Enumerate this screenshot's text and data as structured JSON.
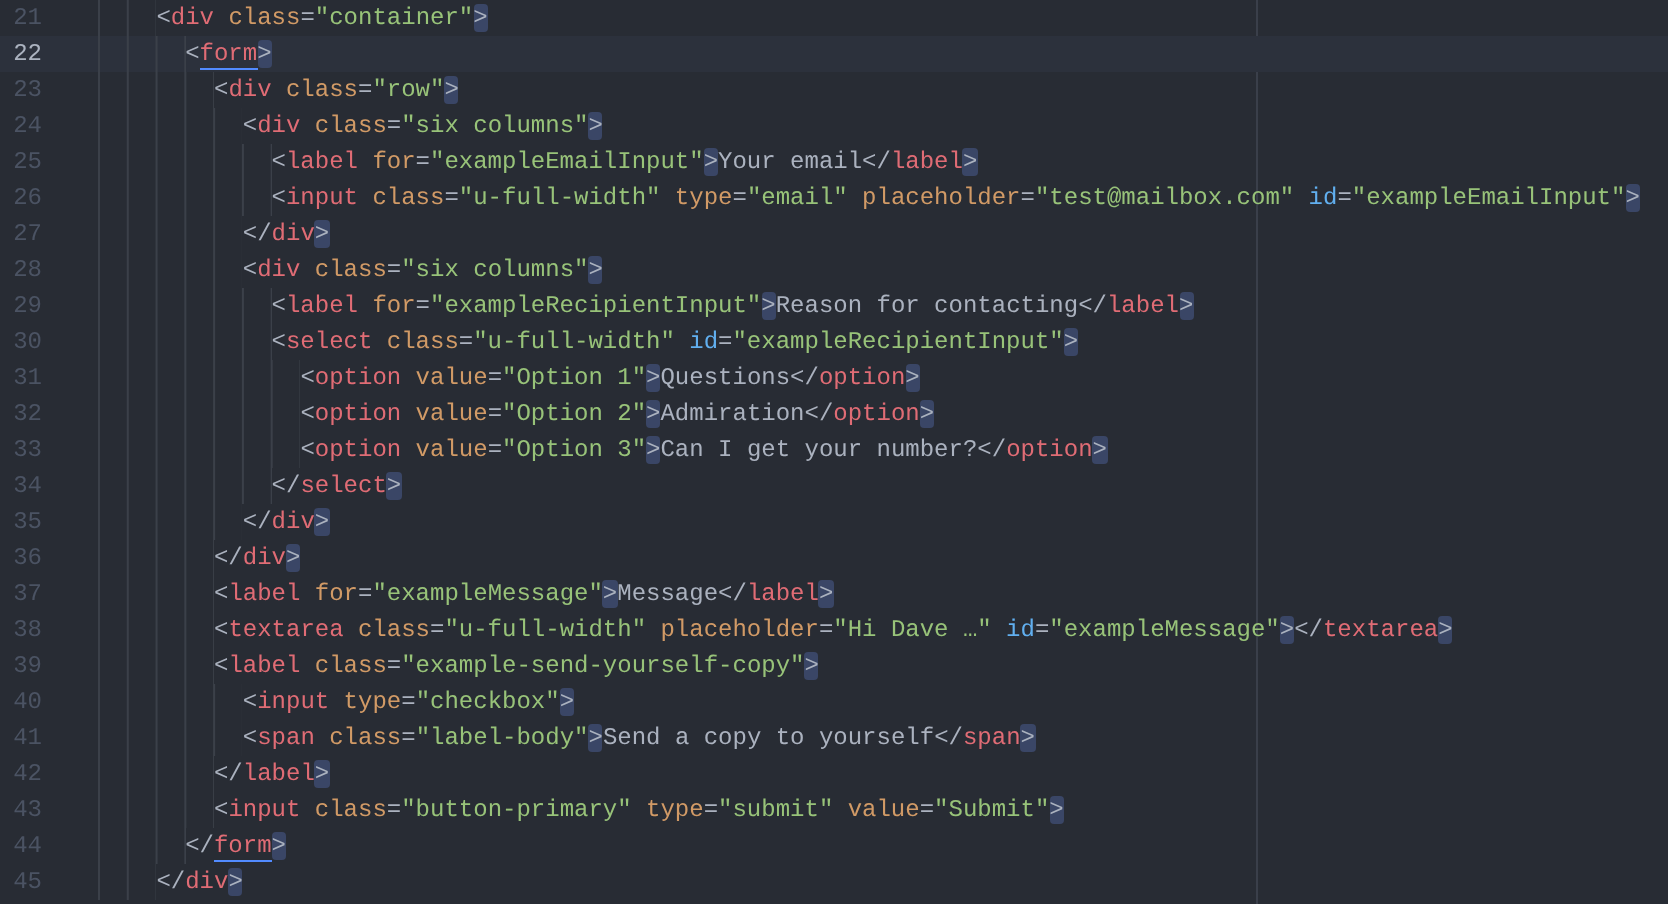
{
  "editor": {
    "lines": [
      {
        "number": "21",
        "current": false,
        "tokens": [
          {
            "kind": "punct",
            "text": "<"
          },
          {
            "kind": "tag",
            "text": "div"
          },
          {
            "kind": "attr",
            "text": "class"
          },
          {
            "kind": "punct",
            "text": "="
          },
          {
            "kind": "string",
            "text": "\"container\""
          },
          {
            "kind": "bracket",
            "text": ">"
          }
        ],
        "children": [
          {
            "number": "22",
            "current": true,
            "tokens": [
              {
                "kind": "punct",
                "text": "<"
              },
              {
                "kind": "tag-match",
                "text": "form"
              },
              {
                "kind": "bracket",
                "text": ">"
              }
            ],
            "children": [
              {
                "number": "23",
                "current": false,
                "tokens": [
                  {
                    "kind": "punct",
                    "text": "<"
                  },
                  {
                    "kind": "tag",
                    "text": "div"
                  },
                  {
                    "kind": "attr",
                    "text": "class"
                  },
                  {
                    "kind": "punct",
                    "text": "="
                  },
                  {
                    "kind": "string",
                    "text": "\"row\""
                  },
                  {
                    "kind": "bracket",
                    "text": ">"
                  }
                ],
                "children": [
                  {
                    "number": "24",
                    "current": false,
                    "tokens": [
                      {
                        "kind": "punct",
                        "text": "<"
                      },
                      {
                        "kind": "tag",
                        "text": "div"
                      },
                      {
                        "kind": "attr",
                        "text": "class"
                      },
                      {
                        "kind": "punct",
                        "text": "="
                      },
                      {
                        "kind": "string",
                        "text": "\"six columns\""
                      },
                      {
                        "kind": "bracket",
                        "text": ">"
                      }
                    ],
                    "children": [
                      {
                        "number": "25",
                        "current": false,
                        "tokens": [
                          {
                            "kind": "punct",
                            "text": "<"
                          },
                          {
                            "kind": "tag",
                            "text": "label"
                          },
                          {
                            "kind": "attr",
                            "text": "for"
                          },
                          {
                            "kind": "punct",
                            "text": "="
                          },
                          {
                            "kind": "string",
                            "text": "\"exampleEmailInput\""
                          },
                          {
                            "kind": "bracket",
                            "text": ">"
                          },
                          {
                            "kind": "text",
                            "text": "Your email"
                          },
                          {
                            "kind": "punct",
                            "text": "</"
                          },
                          {
                            "kind": "tag",
                            "text": "label"
                          },
                          {
                            "kind": "bracket",
                            "text": ">"
                          }
                        ]
                      },
                      {
                        "number": "26",
                        "current": false,
                        "tokens": [
                          {
                            "kind": "punct",
                            "text": "<"
                          },
                          {
                            "kind": "tag",
                            "text": "input"
                          },
                          {
                            "kind": "attr",
                            "text": "class"
                          },
                          {
                            "kind": "punct",
                            "text": "="
                          },
                          {
                            "kind": "string",
                            "text": "\"u-full-width\""
                          },
                          {
                            "kind": "attr",
                            "text": "type"
                          },
                          {
                            "kind": "punct",
                            "text": "="
                          },
                          {
                            "kind": "string",
                            "text": "\"email\""
                          },
                          {
                            "kind": "attr",
                            "text": "placeholder"
                          },
                          {
                            "kind": "punct",
                            "text": "="
                          },
                          {
                            "kind": "string",
                            "text": "\"test@mailbox.com\""
                          },
                          {
                            "kind": "id",
                            "text": "id"
                          },
                          {
                            "kind": "punct",
                            "text": "="
                          },
                          {
                            "kind": "string",
                            "text": "\"exampleEmailInput\""
                          },
                          {
                            "kind": "bracket",
                            "text": ">"
                          }
                        ]
                      }
                    ]
                  },
                  {
                    "number": "27",
                    "current": false,
                    "tokens": [
                      {
                        "kind": "punct",
                        "text": "</"
                      },
                      {
                        "kind": "tag",
                        "text": "div"
                      },
                      {
                        "kind": "bracket",
                        "text": ">"
                      }
                    ]
                  },
                  {
                    "number": "28",
                    "current": false,
                    "tokens": [
                      {
                        "kind": "punct",
                        "text": "<"
                      },
                      {
                        "kind": "tag",
                        "text": "div"
                      },
                      {
                        "kind": "attr",
                        "text": "class"
                      },
                      {
                        "kind": "punct",
                        "text": "="
                      },
                      {
                        "kind": "string",
                        "text": "\"six columns\""
                      },
                      {
                        "kind": "bracket",
                        "text": ">"
                      }
                    ],
                    "children": [
                      {
                        "number": "29",
                        "current": false,
                        "tokens": [
                          {
                            "kind": "punct",
                            "text": "<"
                          },
                          {
                            "kind": "tag",
                            "text": "label"
                          },
                          {
                            "kind": "attr",
                            "text": "for"
                          },
                          {
                            "kind": "punct",
                            "text": "="
                          },
                          {
                            "kind": "string",
                            "text": "\"exampleRecipientInput\""
                          },
                          {
                            "kind": "bracket",
                            "text": ">"
                          },
                          {
                            "kind": "text",
                            "text": "Reason for contacting"
                          },
                          {
                            "kind": "punct",
                            "text": "</"
                          },
                          {
                            "kind": "tag",
                            "text": "label"
                          },
                          {
                            "kind": "bracket",
                            "text": ">"
                          }
                        ]
                      },
                      {
                        "number": "30",
                        "current": false,
                        "tokens": [
                          {
                            "kind": "punct",
                            "text": "<"
                          },
                          {
                            "kind": "tag",
                            "text": "select"
                          },
                          {
                            "kind": "attr",
                            "text": "class"
                          },
                          {
                            "kind": "punct",
                            "text": "="
                          },
                          {
                            "kind": "string",
                            "text": "\"u-full-width\""
                          },
                          {
                            "kind": "id",
                            "text": "id"
                          },
                          {
                            "kind": "punct",
                            "text": "="
                          },
                          {
                            "kind": "string",
                            "text": "\"exampleRecipientInput\""
                          },
                          {
                            "kind": "bracket",
                            "text": ">"
                          }
                        ],
                        "children": [
                          {
                            "number": "31",
                            "current": false,
                            "tokens": [
                              {
                                "kind": "punct",
                                "text": "<"
                              },
                              {
                                "kind": "tag",
                                "text": "option"
                              },
                              {
                                "kind": "attr",
                                "text": "value"
                              },
                              {
                                "kind": "punct",
                                "text": "="
                              },
                              {
                                "kind": "string",
                                "text": "\"Option 1\""
                              },
                              {
                                "kind": "bracket",
                                "text": ">"
                              },
                              {
                                "kind": "text",
                                "text": "Questions"
                              },
                              {
                                "kind": "punct",
                                "text": "</"
                              },
                              {
                                "kind": "tag",
                                "text": "option"
                              },
                              {
                                "kind": "bracket",
                                "text": ">"
                              }
                            ]
                          },
                          {
                            "number": "32",
                            "current": false,
                            "tokens": [
                              {
                                "kind": "punct",
                                "text": "<"
                              },
                              {
                                "kind": "tag",
                                "text": "option"
                              },
                              {
                                "kind": "attr",
                                "text": "value"
                              },
                              {
                                "kind": "punct",
                                "text": "="
                              },
                              {
                                "kind": "string",
                                "text": "\"Option 2\""
                              },
                              {
                                "kind": "bracket",
                                "text": ">"
                              },
                              {
                                "kind": "text",
                                "text": "Admiration"
                              },
                              {
                                "kind": "punct",
                                "text": "</"
                              },
                              {
                                "kind": "tag",
                                "text": "option"
                              },
                              {
                                "kind": "bracket",
                                "text": ">"
                              }
                            ]
                          },
                          {
                            "number": "33",
                            "current": false,
                            "tokens": [
                              {
                                "kind": "punct",
                                "text": "<"
                              },
                              {
                                "kind": "tag",
                                "text": "option"
                              },
                              {
                                "kind": "attr",
                                "text": "value"
                              },
                              {
                                "kind": "punct",
                                "text": "="
                              },
                              {
                                "kind": "string",
                                "text": "\"Option 3\""
                              },
                              {
                                "kind": "bracket",
                                "text": ">"
                              },
                              {
                                "kind": "text",
                                "text": "Can I get your number?"
                              },
                              {
                                "kind": "punct",
                                "text": "</"
                              },
                              {
                                "kind": "tag",
                                "text": "option"
                              },
                              {
                                "kind": "bracket",
                                "text": ">"
                              }
                            ]
                          }
                        ]
                      },
                      {
                        "number": "34",
                        "current": false,
                        "tokens": [
                          {
                            "kind": "punct",
                            "text": "</"
                          },
                          {
                            "kind": "tag",
                            "text": "select"
                          },
                          {
                            "kind": "bracket",
                            "text": ">"
                          }
                        ]
                      }
                    ]
                  },
                  {
                    "number": "35",
                    "current": false,
                    "tokens": [
                      {
                        "kind": "punct",
                        "text": "</"
                      },
                      {
                        "kind": "tag",
                        "text": "div"
                      },
                      {
                        "kind": "bracket",
                        "text": ">"
                      }
                    ]
                  }
                ]
              },
              {
                "number": "36",
                "current": false,
                "tokens": [
                  {
                    "kind": "punct",
                    "text": "</"
                  },
                  {
                    "kind": "tag",
                    "text": "div"
                  },
                  {
                    "kind": "bracket",
                    "text": ">"
                  }
                ]
              },
              {
                "number": "37",
                "current": false,
                "tokens": [
                  {
                    "kind": "punct",
                    "text": "<"
                  },
                  {
                    "kind": "tag",
                    "text": "label"
                  },
                  {
                    "kind": "attr",
                    "text": "for"
                  },
                  {
                    "kind": "punct",
                    "text": "="
                  },
                  {
                    "kind": "string",
                    "text": "\"exampleMessage\""
                  },
                  {
                    "kind": "bracket",
                    "text": ">"
                  },
                  {
                    "kind": "text",
                    "text": "Message"
                  },
                  {
                    "kind": "punct",
                    "text": "</"
                  },
                  {
                    "kind": "tag",
                    "text": "label"
                  },
                  {
                    "kind": "bracket",
                    "text": ">"
                  }
                ]
              },
              {
                "number": "38",
                "current": false,
                "tokens": [
                  {
                    "kind": "punct",
                    "text": "<"
                  },
                  {
                    "kind": "tag",
                    "text": "textarea"
                  },
                  {
                    "kind": "attr",
                    "text": "class"
                  },
                  {
                    "kind": "punct",
                    "text": "="
                  },
                  {
                    "kind": "string",
                    "text": "\"u-full-width\""
                  },
                  {
                    "kind": "attr",
                    "text": "placeholder"
                  },
                  {
                    "kind": "punct",
                    "text": "="
                  },
                  {
                    "kind": "string",
                    "text": "\"Hi Dave …\""
                  },
                  {
                    "kind": "id",
                    "text": "id"
                  },
                  {
                    "kind": "punct",
                    "text": "="
                  },
                  {
                    "kind": "string",
                    "text": "\"exampleMessage\""
                  },
                  {
                    "kind": "bracket",
                    "text": ">"
                  },
                  {
                    "kind": "punct",
                    "text": "</"
                  },
                  {
                    "kind": "tag",
                    "text": "textarea"
                  },
                  {
                    "kind": "bracket",
                    "text": ">"
                  }
                ]
              },
              {
                "number": "39",
                "current": false,
                "tokens": [
                  {
                    "kind": "punct",
                    "text": "<"
                  },
                  {
                    "kind": "tag",
                    "text": "label"
                  },
                  {
                    "kind": "attr",
                    "text": "class"
                  },
                  {
                    "kind": "punct",
                    "text": "="
                  },
                  {
                    "kind": "string",
                    "text": "\"example-send-yourself-copy\""
                  },
                  {
                    "kind": "bracket",
                    "text": ">"
                  }
                ],
                "children": [
                  {
                    "number": "40",
                    "current": false,
                    "tokens": [
                      {
                        "kind": "punct",
                        "text": "<"
                      },
                      {
                        "kind": "tag",
                        "text": "input"
                      },
                      {
                        "kind": "attr",
                        "text": "type"
                      },
                      {
                        "kind": "punct",
                        "text": "="
                      },
                      {
                        "kind": "string",
                        "text": "\"checkbox\""
                      },
                      {
                        "kind": "bracket",
                        "text": ">"
                      }
                    ]
                  },
                  {
                    "number": "41",
                    "current": false,
                    "tokens": [
                      {
                        "kind": "punct",
                        "text": "<"
                      },
                      {
                        "kind": "tag",
                        "text": "span"
                      },
                      {
                        "kind": "attr",
                        "text": "class"
                      },
                      {
                        "kind": "punct",
                        "text": "="
                      },
                      {
                        "kind": "string",
                        "text": "\"label-body\""
                      },
                      {
                        "kind": "bracket",
                        "text": ">"
                      },
                      {
                        "kind": "text",
                        "text": "Send a copy to yourself"
                      },
                      {
                        "kind": "punct",
                        "text": "</"
                      },
                      {
                        "kind": "tag",
                        "text": "span"
                      },
                      {
                        "kind": "bracket",
                        "text": ">"
                      }
                    ]
                  }
                ]
              },
              {
                "number": "42",
                "current": false,
                "tokens": [
                  {
                    "kind": "punct",
                    "text": "</"
                  },
                  {
                    "kind": "tag",
                    "text": "label"
                  },
                  {
                    "kind": "bracket",
                    "text": ">"
                  }
                ]
              },
              {
                "number": "43",
                "current": false,
                "tokens": [
                  {
                    "kind": "punct",
                    "text": "<"
                  },
                  {
                    "kind": "tag",
                    "text": "input"
                  },
                  {
                    "kind": "attr",
                    "text": "class"
                  },
                  {
                    "kind": "punct",
                    "text": "="
                  },
                  {
                    "kind": "string",
                    "text": "\"button-primary\""
                  },
                  {
                    "kind": "attr",
                    "text": "type"
                  },
                  {
                    "kind": "punct",
                    "text": "="
                  },
                  {
                    "kind": "string",
                    "text": "\"submit\""
                  },
                  {
                    "kind": "attr",
                    "text": "value"
                  },
                  {
                    "kind": "punct",
                    "text": "="
                  },
                  {
                    "kind": "string",
                    "text": "\"Submit\""
                  },
                  {
                    "kind": "bracket",
                    "text": ">"
                  }
                ]
              }
            ]
          },
          {
            "number": "44",
            "current": false,
            "tokens": [
              {
                "kind": "punct",
                "text": "</"
              },
              {
                "kind": "tag-match",
                "text": "form"
              },
              {
                "kind": "bracket",
                "text": ">"
              }
            ]
          }
        ]
      },
      {
        "number": "45",
        "current": false,
        "tokens": [
          {
            "kind": "punct",
            "text": "</"
          },
          {
            "kind": "tag",
            "text": "div"
          },
          {
            "kind": "bracket",
            "text": ">"
          }
        ]
      }
    ]
  }
}
